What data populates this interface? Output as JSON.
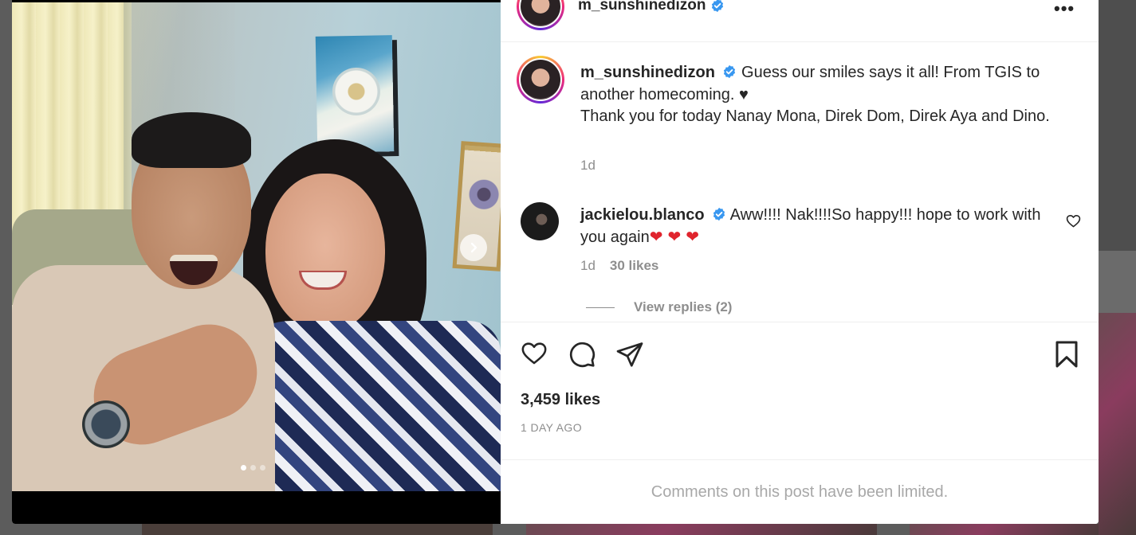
{
  "post": {
    "username": "m_sunshinedizon",
    "verified": true,
    "more_label": "•••",
    "caption": {
      "username": "m_sunshinedizon",
      "text_line1": " Guess our smiles says it all! From TGIS to another homecoming. ♥",
      "text_line2": "Thank you for today Nanay Mona, Direk Dom, Direk Aya and Dino.",
      "time": "1d"
    },
    "comment": {
      "username": "jackielou.blanco",
      "text": " Aww!!!! Nak!!!!So happy!!! hope to work with you again",
      "hearts": "❤❤❤",
      "time": "1d",
      "likes": "30 likes",
      "view_replies": "View replies (2)"
    },
    "likes": "3,459 likes",
    "date": "1 DAY AGO",
    "comments_limited": "Comments on this post have been limited."
  },
  "carousel": {
    "slides": 3,
    "current": 1
  },
  "colors": {
    "verified": "#3897f0",
    "heart_red": "#e0242d",
    "muted_text": "#8e8e8e"
  },
  "icons": {
    "like": "heart-icon",
    "comment": "comment-icon",
    "share": "send-icon",
    "save": "bookmark-icon",
    "next": "chevron-right-icon"
  }
}
